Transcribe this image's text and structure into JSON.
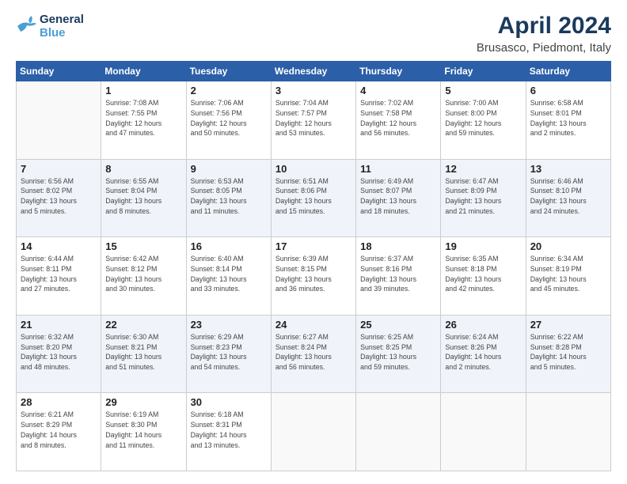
{
  "logo": {
    "line1": "General",
    "line2": "Blue"
  },
  "title": "April 2024",
  "subtitle": "Brusasco, Piedmont, Italy",
  "headers": [
    "Sunday",
    "Monday",
    "Tuesday",
    "Wednesday",
    "Thursday",
    "Friday",
    "Saturday"
  ],
  "weeks": [
    [
      {
        "day": "",
        "info": ""
      },
      {
        "day": "1",
        "info": "Sunrise: 7:08 AM\nSunset: 7:55 PM\nDaylight: 12 hours\nand 47 minutes."
      },
      {
        "day": "2",
        "info": "Sunrise: 7:06 AM\nSunset: 7:56 PM\nDaylight: 12 hours\nand 50 minutes."
      },
      {
        "day": "3",
        "info": "Sunrise: 7:04 AM\nSunset: 7:57 PM\nDaylight: 12 hours\nand 53 minutes."
      },
      {
        "day": "4",
        "info": "Sunrise: 7:02 AM\nSunset: 7:58 PM\nDaylight: 12 hours\nand 56 minutes."
      },
      {
        "day": "5",
        "info": "Sunrise: 7:00 AM\nSunset: 8:00 PM\nDaylight: 12 hours\nand 59 minutes."
      },
      {
        "day": "6",
        "info": "Sunrise: 6:58 AM\nSunset: 8:01 PM\nDaylight: 13 hours\nand 2 minutes."
      }
    ],
    [
      {
        "day": "7",
        "info": "Sunrise: 6:56 AM\nSunset: 8:02 PM\nDaylight: 13 hours\nand 5 minutes."
      },
      {
        "day": "8",
        "info": "Sunrise: 6:55 AM\nSunset: 8:04 PM\nDaylight: 13 hours\nand 8 minutes."
      },
      {
        "day": "9",
        "info": "Sunrise: 6:53 AM\nSunset: 8:05 PM\nDaylight: 13 hours\nand 11 minutes."
      },
      {
        "day": "10",
        "info": "Sunrise: 6:51 AM\nSunset: 8:06 PM\nDaylight: 13 hours\nand 15 minutes."
      },
      {
        "day": "11",
        "info": "Sunrise: 6:49 AM\nSunset: 8:07 PM\nDaylight: 13 hours\nand 18 minutes."
      },
      {
        "day": "12",
        "info": "Sunrise: 6:47 AM\nSunset: 8:09 PM\nDaylight: 13 hours\nand 21 minutes."
      },
      {
        "day": "13",
        "info": "Sunrise: 6:46 AM\nSunset: 8:10 PM\nDaylight: 13 hours\nand 24 minutes."
      }
    ],
    [
      {
        "day": "14",
        "info": "Sunrise: 6:44 AM\nSunset: 8:11 PM\nDaylight: 13 hours\nand 27 minutes."
      },
      {
        "day": "15",
        "info": "Sunrise: 6:42 AM\nSunset: 8:12 PM\nDaylight: 13 hours\nand 30 minutes."
      },
      {
        "day": "16",
        "info": "Sunrise: 6:40 AM\nSunset: 8:14 PM\nDaylight: 13 hours\nand 33 minutes."
      },
      {
        "day": "17",
        "info": "Sunrise: 6:39 AM\nSunset: 8:15 PM\nDaylight: 13 hours\nand 36 minutes."
      },
      {
        "day": "18",
        "info": "Sunrise: 6:37 AM\nSunset: 8:16 PM\nDaylight: 13 hours\nand 39 minutes."
      },
      {
        "day": "19",
        "info": "Sunrise: 6:35 AM\nSunset: 8:18 PM\nDaylight: 13 hours\nand 42 minutes."
      },
      {
        "day": "20",
        "info": "Sunrise: 6:34 AM\nSunset: 8:19 PM\nDaylight: 13 hours\nand 45 minutes."
      }
    ],
    [
      {
        "day": "21",
        "info": "Sunrise: 6:32 AM\nSunset: 8:20 PM\nDaylight: 13 hours\nand 48 minutes."
      },
      {
        "day": "22",
        "info": "Sunrise: 6:30 AM\nSunset: 8:21 PM\nDaylight: 13 hours\nand 51 minutes."
      },
      {
        "day": "23",
        "info": "Sunrise: 6:29 AM\nSunset: 8:23 PM\nDaylight: 13 hours\nand 54 minutes."
      },
      {
        "day": "24",
        "info": "Sunrise: 6:27 AM\nSunset: 8:24 PM\nDaylight: 13 hours\nand 56 minutes."
      },
      {
        "day": "25",
        "info": "Sunrise: 6:25 AM\nSunset: 8:25 PM\nDaylight: 13 hours\nand 59 minutes."
      },
      {
        "day": "26",
        "info": "Sunrise: 6:24 AM\nSunset: 8:26 PM\nDaylight: 14 hours\nand 2 minutes."
      },
      {
        "day": "27",
        "info": "Sunrise: 6:22 AM\nSunset: 8:28 PM\nDaylight: 14 hours\nand 5 minutes."
      }
    ],
    [
      {
        "day": "28",
        "info": "Sunrise: 6:21 AM\nSunset: 8:29 PM\nDaylight: 14 hours\nand 8 minutes."
      },
      {
        "day": "29",
        "info": "Sunrise: 6:19 AM\nSunset: 8:30 PM\nDaylight: 14 hours\nand 11 minutes."
      },
      {
        "day": "30",
        "info": "Sunrise: 6:18 AM\nSunset: 8:31 PM\nDaylight: 14 hours\nand 13 minutes."
      },
      {
        "day": "",
        "info": ""
      },
      {
        "day": "",
        "info": ""
      },
      {
        "day": "",
        "info": ""
      },
      {
        "day": "",
        "info": ""
      }
    ]
  ]
}
